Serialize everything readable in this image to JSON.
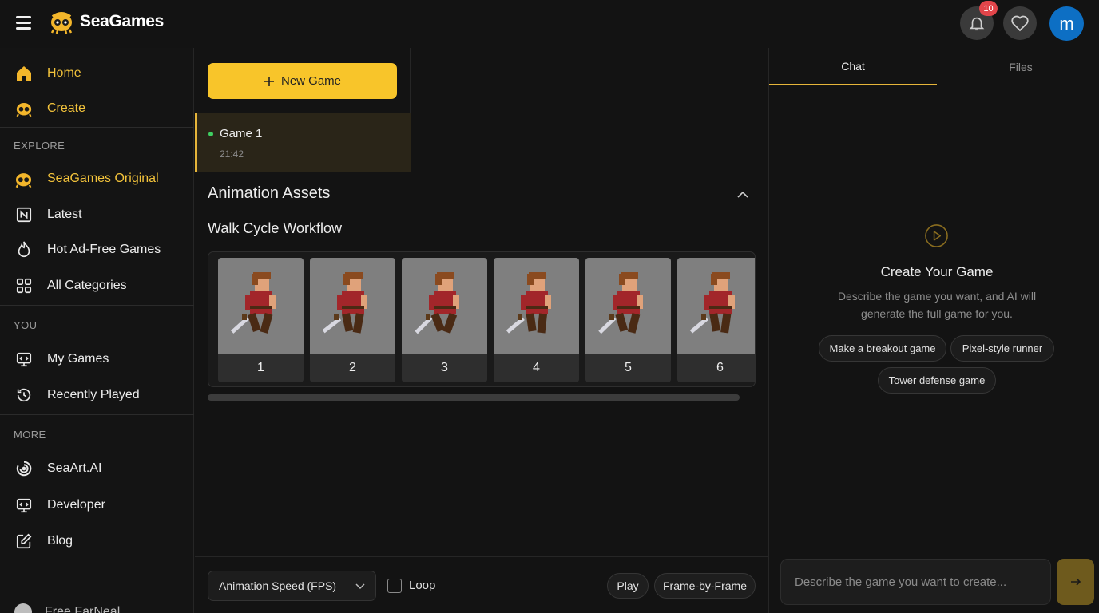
{
  "header": {
    "brand": "SeaGames",
    "notification_count": "10",
    "avatar_initial": "m"
  },
  "sidebar": {
    "primary": [
      {
        "label": "Home",
        "icon": "home-icon"
      },
      {
        "label": "Create",
        "icon": "seagames-mascot-icon"
      }
    ],
    "explore_title": "EXPLORE",
    "explore": [
      {
        "label": "SeaGames Original",
        "icon": "seagames-mascot-icon"
      },
      {
        "label": "Latest",
        "icon": "new-icon"
      },
      {
        "label": "Hot Ad-Free Games",
        "icon": "flame-icon"
      },
      {
        "label": "All Categories",
        "icon": "grid-icon"
      }
    ],
    "you_title": "YOU",
    "you": [
      {
        "label": "My Games",
        "icon": "my-games-icon"
      },
      {
        "label": "Recently Played",
        "icon": "history-icon"
      }
    ],
    "more_title": "MORE",
    "more": [
      {
        "label": "SeaArt.AI",
        "icon": "seaart-icon"
      },
      {
        "label": "Developer",
        "icon": "code-icon"
      },
      {
        "label": "Blog",
        "icon": "edit-icon"
      }
    ],
    "footer_partial": "Free FarNeal"
  },
  "game_list": {
    "new_game_label": "New Game",
    "items": [
      {
        "name": "Game 1",
        "time": "21:42",
        "status": "active"
      }
    ]
  },
  "assets": {
    "section_title": "Animation Assets",
    "workflow_title": "Walk Cycle Workflow",
    "frames": [
      "1",
      "2",
      "3",
      "4",
      "5",
      "6"
    ]
  },
  "controls": {
    "fps_label": "Animation Speed (FPS)",
    "loop_label": "Loop",
    "loop_checked": false,
    "play_label": "Play",
    "frame_by_frame_label": "Frame-by-Frame"
  },
  "chat_panel": {
    "tabs": [
      "Chat",
      "Files"
    ],
    "active_tab": "Chat",
    "empty_title": "Create Your Game",
    "empty_desc": "Describe the game you want, and AI will generate the full game for you.",
    "suggestions": [
      "Make a breakout game",
      "Pixel-style runner",
      "Tower defense game"
    ],
    "input_placeholder": "Describe the game you want to create..."
  },
  "colors": {
    "accent": "#f8c52a",
    "active_dot": "#3fcf61",
    "badge": "#e2454a",
    "avatar": "#0d6fc4"
  }
}
